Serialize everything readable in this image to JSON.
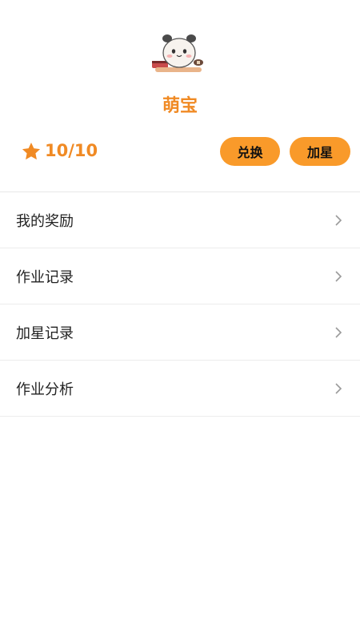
{
  "profile": {
    "name": "萌宝",
    "score": "10/10",
    "exchange_label": "兑换",
    "add_star_label": "加星",
    "avatar_icon": "panda-avatar-icon",
    "star_icon": "star-icon"
  },
  "menu": {
    "items": [
      {
        "label": "我的奖励"
      },
      {
        "label": "作业记录"
      },
      {
        "label": "加星记录"
      },
      {
        "label": "作业分析"
      }
    ]
  },
  "colors": {
    "accent": "#f08a24",
    "button": "#f99a2a",
    "divider": "#ececec"
  }
}
